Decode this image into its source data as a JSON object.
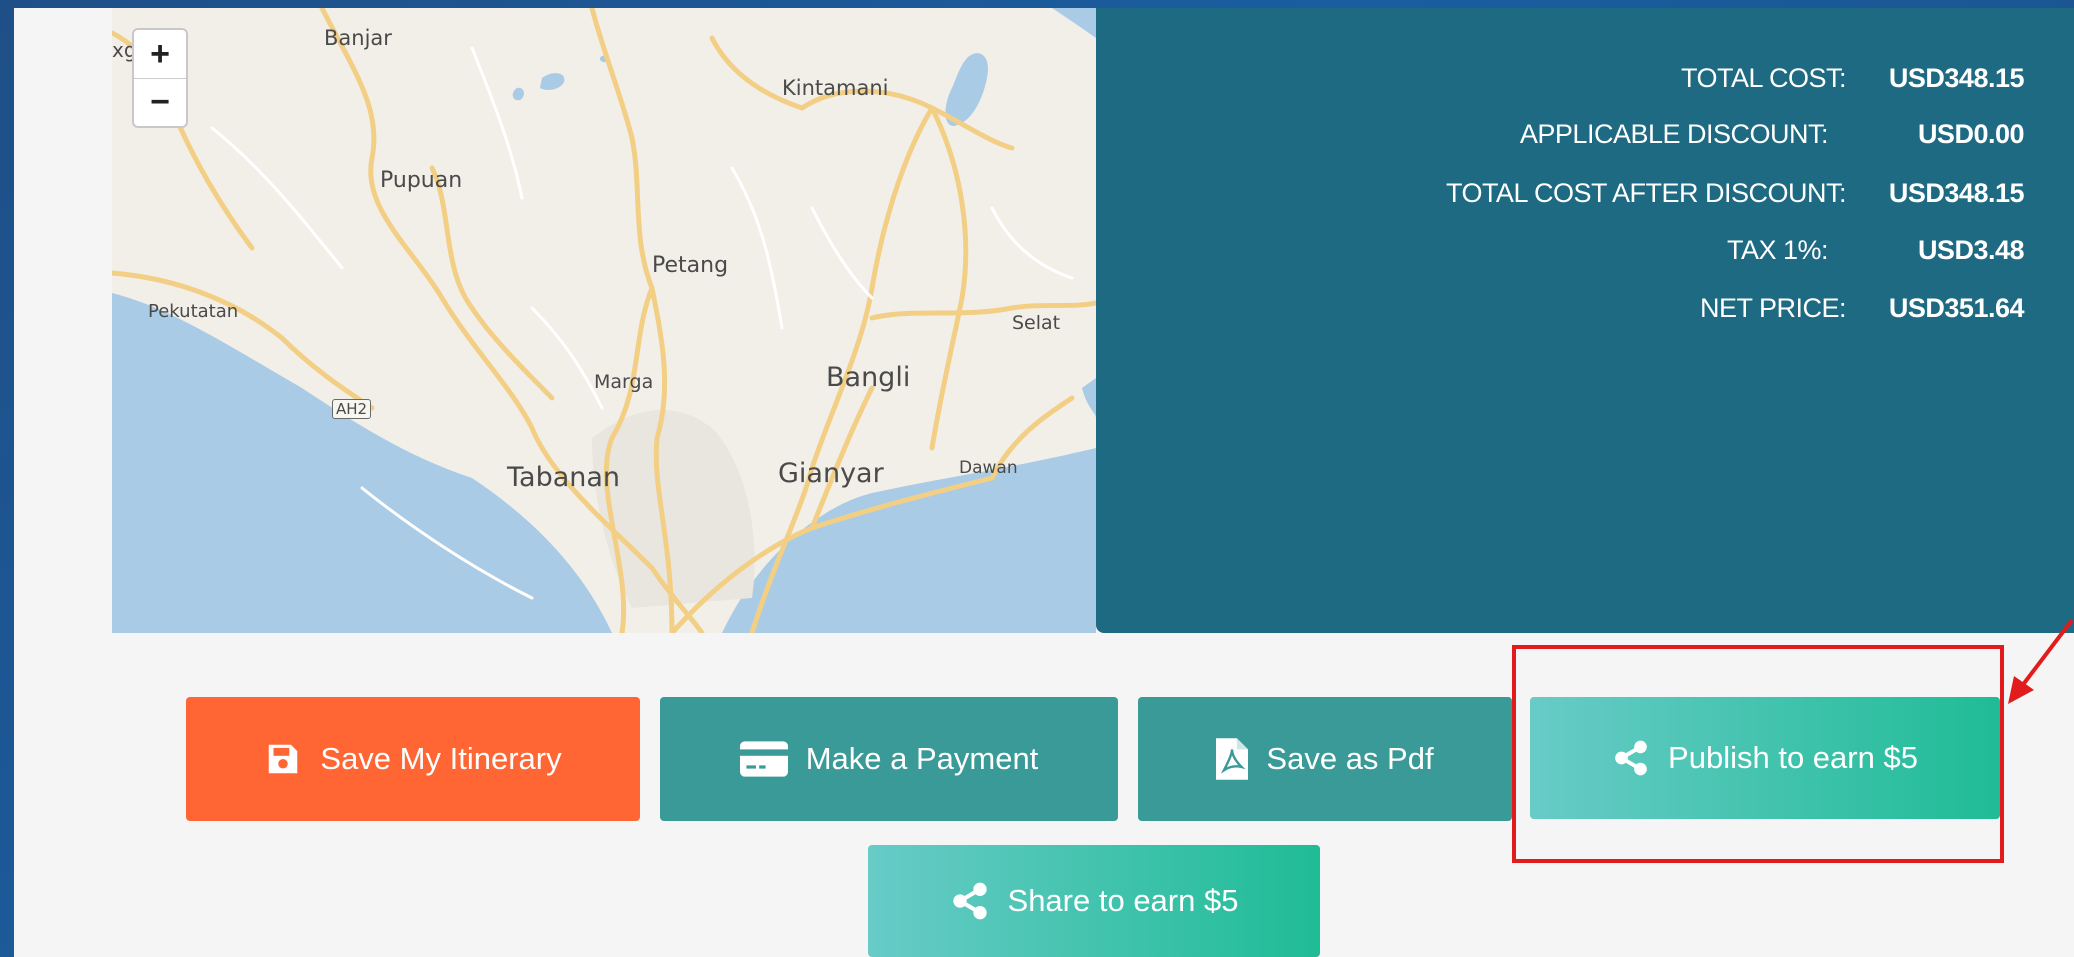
{
  "map": {
    "zoom_in": "+",
    "zoom_out": "−",
    "labels": {
      "edge": "xg",
      "banjar": "Banjar",
      "kintamani": "Kintamani",
      "pupuan": "Pupuan",
      "petang": "Petang",
      "pekutatan": "Pekutatan",
      "selat": "Selat",
      "marga": "Marga",
      "bangli": "Bangli",
      "ah2": "AH2",
      "tabanan": "Tabanan",
      "gianyar": "Gianyar",
      "dawan": "Dawan"
    }
  },
  "summary": {
    "rows": [
      {
        "label": "TOTAL COST:",
        "value": "USD348.15"
      },
      {
        "label": "APPLICABLE DISCOUNT:",
        "value": "USD0.00"
      },
      {
        "label": "TOTAL COST AFTER DISCOUNT:",
        "value": "USD348.15"
      },
      {
        "label": "TAX 1%:",
        "value": "USD3.48"
      },
      {
        "label": "NET PRICE:",
        "value": "USD351.64"
      }
    ]
  },
  "buttons": {
    "save_itinerary": "Save My Itinerary",
    "make_payment": "Make a Payment",
    "save_pdf": "Save as Pdf",
    "publish": "Publish to earn $5",
    "share": "Share to earn $5"
  },
  "colors": {
    "orange": "#ff6633",
    "teal": "#3a9a97",
    "panel": "#1e6a82",
    "highlight": "#e21c1c"
  },
  "icons": {
    "save": "floppy-disk-icon",
    "payment": "credit-card-icon",
    "pdf": "pdf-file-icon",
    "share": "share-icon",
    "annotation": "red-arrow-icon"
  }
}
